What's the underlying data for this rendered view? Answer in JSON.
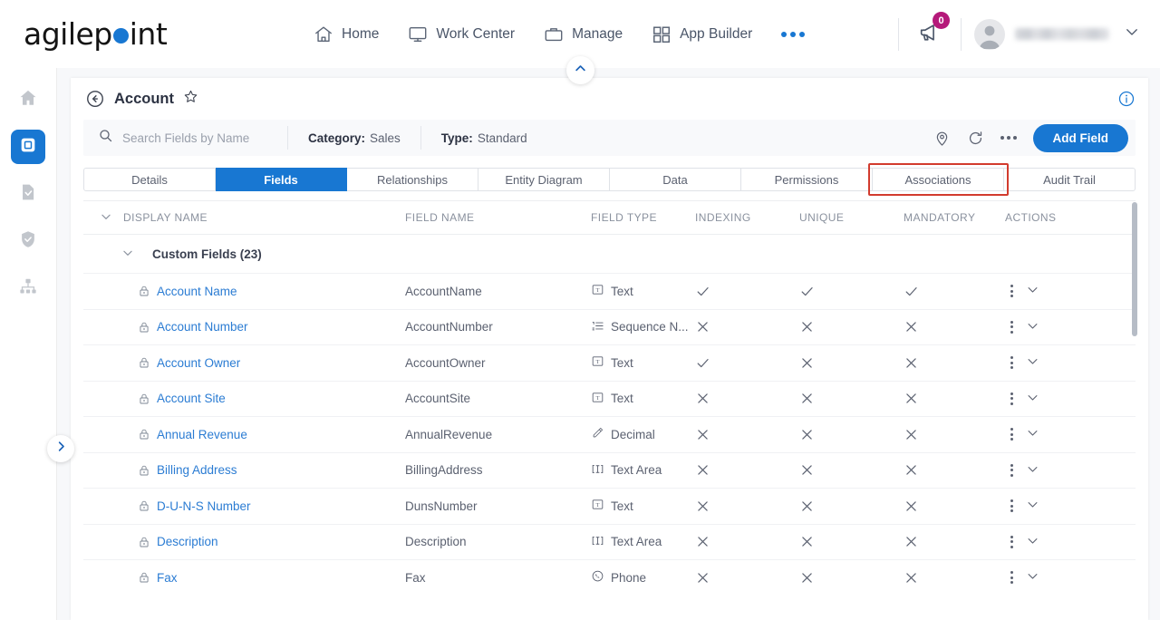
{
  "brand": {
    "name_part1": "agilep",
    "name_part2": "int",
    "accent": "#1877d2"
  },
  "topnav": {
    "items": [
      {
        "label": "Home",
        "icon": "home-icon"
      },
      {
        "label": "Work Center",
        "icon": "monitor-icon"
      },
      {
        "label": "Manage",
        "icon": "briefcase-icon"
      },
      {
        "label": "App Builder",
        "icon": "grid-icon"
      }
    ],
    "more_label": "more-options",
    "notification_count": "0",
    "notification_badge_color": "#b5197a",
    "user_name": ""
  },
  "rail": {
    "items": [
      {
        "name": "sidebar-item-home",
        "icon": "home-icon",
        "active": false
      },
      {
        "name": "sidebar-item-app-builder",
        "icon": "app-window-icon",
        "active": true
      },
      {
        "name": "sidebar-item-forms",
        "icon": "document-check-icon",
        "active": false
      },
      {
        "name": "sidebar-item-security",
        "icon": "shield-check-icon",
        "active": false
      },
      {
        "name": "sidebar-item-hierarchy",
        "icon": "hierarchy-icon",
        "active": false
      }
    ]
  },
  "page": {
    "title": "Account",
    "back_icon": "back-arrow-icon",
    "favorite_icon": "star-icon",
    "info_icon": "info-circle-icon"
  },
  "filterbar": {
    "search_placeholder": "Search Fields by Name",
    "search_value": "",
    "search_icon": "search-icon",
    "category_label": "Category:",
    "category_value": "Sales",
    "type_label": "Type:",
    "type_value": "Standard",
    "pin_icon": "map-pin-icon",
    "refresh_icon": "refresh-icon",
    "more_icon": "ellipsis-icon",
    "add_button": "Add Field"
  },
  "tabs": [
    {
      "label": "Details",
      "active": false,
      "highlighted": false
    },
    {
      "label": "Fields",
      "active": true,
      "highlighted": false
    },
    {
      "label": "Relationships",
      "active": false,
      "highlighted": false
    },
    {
      "label": "Entity Diagram",
      "active": false,
      "highlighted": false
    },
    {
      "label": "Data",
      "active": false,
      "highlighted": false
    },
    {
      "label": "Permissions",
      "active": false,
      "highlighted": false
    },
    {
      "label": "Associations",
      "active": false,
      "highlighted": true
    },
    {
      "label": "Audit Trail",
      "active": false,
      "highlighted": false
    }
  ],
  "table": {
    "headers": {
      "display_name": "DISPLAY NAME",
      "field_name": "FIELD NAME",
      "field_type": "FIELD TYPE",
      "indexing": "INDEXING",
      "unique": "UNIQUE",
      "mandatory": "MANDATORY",
      "actions": "ACTIONS"
    },
    "group": {
      "label": "Custom Fields (23)",
      "expanded": true
    },
    "rows": [
      {
        "display_name": "Account Name",
        "field_name": "AccountName",
        "field_type": "Text",
        "type_icon": "text-icon",
        "indexing": "check",
        "unique": "check",
        "mandatory": "check"
      },
      {
        "display_name": "Account Number",
        "field_name": "AccountNumber",
        "field_type": "Sequence N...",
        "type_icon": "list-icon",
        "indexing": "cross",
        "unique": "cross",
        "mandatory": "cross"
      },
      {
        "display_name": "Account Owner",
        "field_name": "AccountOwner",
        "field_type": "Text",
        "type_icon": "text-icon",
        "indexing": "check",
        "unique": "cross",
        "mandatory": "cross"
      },
      {
        "display_name": "Account Site",
        "field_name": "AccountSite",
        "field_type": "Text",
        "type_icon": "text-icon",
        "indexing": "cross",
        "unique": "cross",
        "mandatory": "cross"
      },
      {
        "display_name": "Annual Revenue",
        "field_name": "AnnualRevenue",
        "field_type": "Decimal",
        "type_icon": "pencil-icon",
        "indexing": "cross",
        "unique": "cross",
        "mandatory": "cross"
      },
      {
        "display_name": "Billing Address",
        "field_name": "BillingAddress",
        "field_type": "Text Area",
        "type_icon": "text-area-icon",
        "indexing": "cross",
        "unique": "cross",
        "mandatory": "cross"
      },
      {
        "display_name": "D-U-N-S Number",
        "field_name": "DunsNumber",
        "field_type": "Text",
        "type_icon": "text-icon",
        "indexing": "cross",
        "unique": "cross",
        "mandatory": "cross"
      },
      {
        "display_name": "Description",
        "field_name": "Description",
        "field_type": "Text Area",
        "type_icon": "text-area-icon",
        "indexing": "cross",
        "unique": "cross",
        "mandatory": "cross"
      },
      {
        "display_name": "Fax",
        "field_name": "Fax",
        "field_type": "Phone",
        "type_icon": "phone-icon",
        "indexing": "cross",
        "unique": "cross",
        "mandatory": "cross"
      }
    ]
  }
}
